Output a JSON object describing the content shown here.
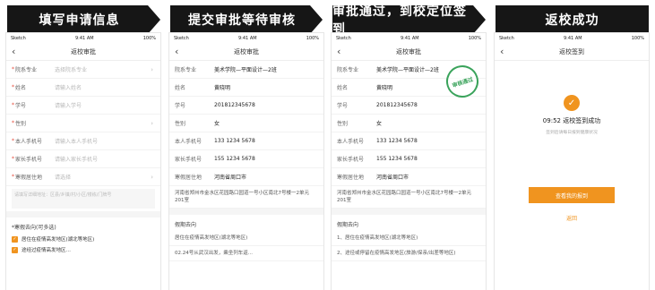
{
  "steps": [
    {
      "label": "填写申请信息"
    },
    {
      "label": "提交审批等待审核"
    },
    {
      "label": "审批通过，到校定位签到"
    },
    {
      "label": "返校成功"
    }
  ],
  "statusbar": {
    "carrier": "Sketch",
    "time": "9:41 AM",
    "battery": "100%"
  },
  "screen1": {
    "title": "返校审批",
    "fields": [
      {
        "label": "院系专业",
        "placeholder": "选择院系专业"
      },
      {
        "label": "姓名",
        "placeholder": "请输入姓名"
      },
      {
        "label": "学号",
        "placeholder": "请输入学号"
      },
      {
        "label": "性别",
        "placeholder": ""
      },
      {
        "label": "本人手机号",
        "placeholder": "请输入本人手机号"
      },
      {
        "label": "家长手机号",
        "placeholder": "请输入家长手机号"
      },
      {
        "label": "寒假居住地",
        "placeholder": "请选择"
      }
    ],
    "address_placeholder": "请填写详细地址：区县/乡镇/村/小区/楼栋/门牌号",
    "section_title": "*寒假去向(可多选)",
    "option1": "居住在疫情高发地区(湖北等地区)",
    "option2": "途经过疫情高发地区…"
  },
  "screen2": {
    "title": "返校审批",
    "fields": [
      {
        "label": "院系专业",
        "value": "美术学院—平面设计—2班"
      },
      {
        "label": "姓名",
        "value": "黄晓明"
      },
      {
        "label": "学号",
        "value": "201812345678"
      },
      {
        "label": "性别",
        "value": "女"
      },
      {
        "label": "本人手机号",
        "value": "133 1234 5678"
      },
      {
        "label": "家长手机号",
        "value": "155 1234 5678"
      },
      {
        "label": "寒假居住地",
        "value": "河南省周口市"
      }
    ],
    "address": "河南省郑州市金水区花园路口园道一号小区南北7号楼一2单元201室",
    "section_title": "假期去向",
    "option1": "居住在疫情高发地区(湖北等地区)",
    "option2": "02.24号从武汉出发，乘坐列车返..."
  },
  "screen3": {
    "title": "返校审批",
    "stamp": "审核通过",
    "fields": [
      {
        "label": "院系专业",
        "value": "美术学院—平面设计—2班"
      },
      {
        "label": "姓名",
        "value": "黄晓明"
      },
      {
        "label": "学号",
        "value": "201812345678"
      },
      {
        "label": "性别",
        "value": "女"
      },
      {
        "label": "本人手机号",
        "value": "133 1234 5678"
      },
      {
        "label": "家长手机号",
        "value": "155 1234 5678"
      },
      {
        "label": "寒假居住地",
        "value": "河南省周口市"
      }
    ],
    "address": "河南省郑州市金水区花园路口园道一号小区南北7号楼一2单元201室",
    "section_title": "假期去向",
    "option1": "1、居住在疫情高发地区(湖北等地区)",
    "option2": "2、途径或停留在疫情高发地区(旅游/探亲/出差等地区)"
  },
  "screen4": {
    "title": "返校签到",
    "success_text": "09:52 返校签到成功",
    "sub_text": "签到后请每日报到健康状况",
    "primary_button": "查看我的报到",
    "link_button": "返回"
  }
}
